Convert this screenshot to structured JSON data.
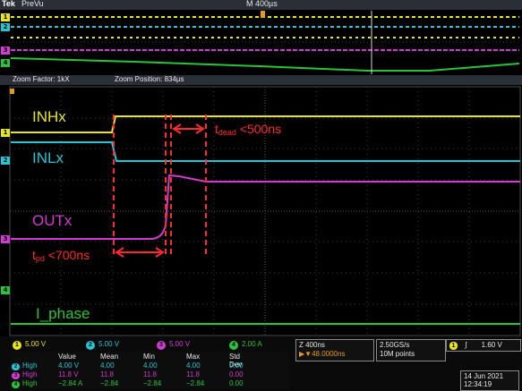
{
  "topbar": {
    "brand": "Tek",
    "mode": "PreVu",
    "timebase": "M 400µs"
  },
  "zoombar": {
    "zoom_factor": "Zoom Factor: 1kX",
    "zoom_position": "Zoom Position: 834µs"
  },
  "channels": {
    "ch1": {
      "label": "1",
      "color": "#e6e61a"
    },
    "ch2": {
      "label": "2",
      "color": "#22c6d6"
    },
    "ch3": {
      "label": "3",
      "color": "#d23bd2"
    },
    "ch4": {
      "label": "4",
      "color": "#29c43a"
    }
  },
  "annotations": {
    "inh": "INHx",
    "inl": "INLx",
    "out": "OUTx",
    "iphase": "I_phase",
    "tdead_t": "t",
    "tdead_sub": "dead",
    "tdead_val": " <500ns",
    "tpd_t": "t",
    "tpd_sub": "pd",
    "tpd_val": " <700ns"
  },
  "scales": [
    {
      "ch": "1",
      "value": "5.00 V",
      "color": "#e6e61a"
    },
    {
      "ch": "2",
      "value": "5.00 V",
      "color": "#22c6d6"
    },
    {
      "ch": "3",
      "value": "5.00 V",
      "color": "#d23bd2"
    },
    {
      "ch": "4",
      "value": "2.00 A",
      "color": "#29c43a"
    }
  ],
  "zoom_info": {
    "line1": "Z 400ns",
    "line2": "▶▼48.0000ns"
  },
  "acq": {
    "rate": "2.50GS/s",
    "points": "10M points"
  },
  "trigger": {
    "ch": "1",
    "slope": "∫",
    "level": "1.60 V"
  },
  "measurements": {
    "headers": [
      "Value",
      "Mean",
      "Min",
      "Max",
      "Std Dev"
    ],
    "rows": [
      {
        "ch": "2",
        "label": "High",
        "color": "#22c6d6",
        "values": [
          "4.00 V",
          "4.00",
          "4.00",
          "4.00",
          "0.00"
        ]
      },
      {
        "ch": "3",
        "label": "High",
        "color": "#d23bd2",
        "values": [
          "11.8 V",
          "11.8",
          "11.8",
          "11.8",
          "0.00"
        ]
      },
      {
        "ch": "4",
        "label": "High",
        "color": "#29c43a",
        "values": [
          "−2.84 A",
          "−2.84",
          "−2.84",
          "−2.84",
          "0.00"
        ]
      }
    ]
  },
  "datetime": {
    "date": "14 Jun 2021",
    "time": "12:34:19"
  }
}
